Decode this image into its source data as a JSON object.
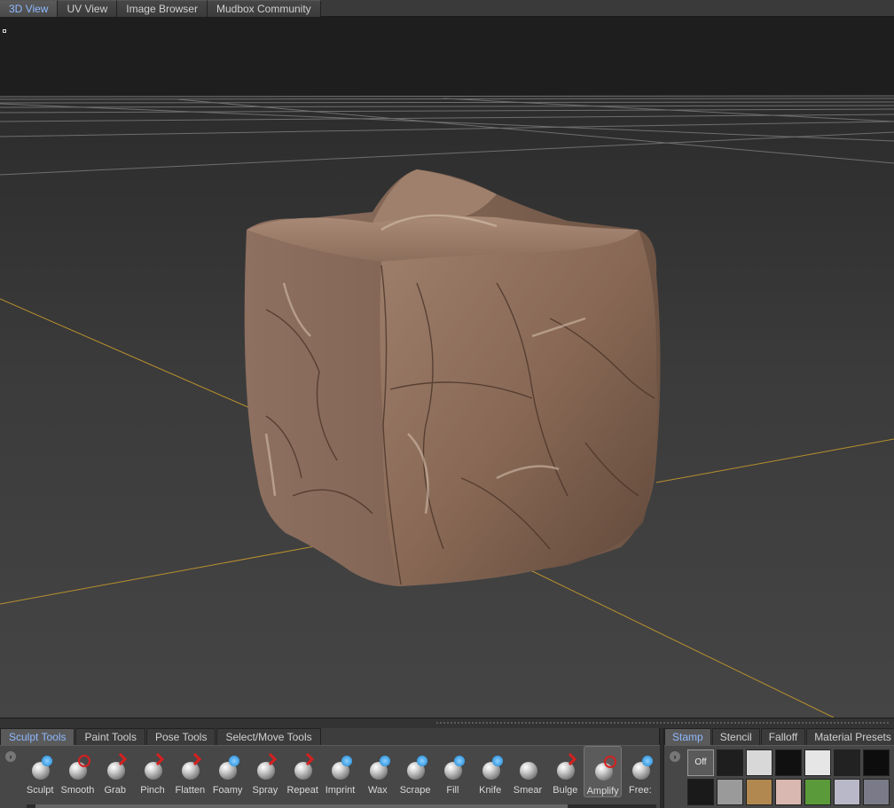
{
  "top_tabs": [
    {
      "label": "3D View",
      "active": true
    },
    {
      "label": "UV View",
      "active": false
    },
    {
      "label": "Image Browser",
      "active": false
    },
    {
      "label": "Mudbox Community",
      "active": false
    }
  ],
  "viewport": {
    "model_color": "#8a6a58",
    "grid_color": "#8a8a8a",
    "axis_color": "#b8902e"
  },
  "tool_tray": {
    "tabs": [
      {
        "label": "Sculpt Tools",
        "active": true
      },
      {
        "label": "Paint Tools",
        "active": false
      },
      {
        "label": "Pose Tools",
        "active": false
      },
      {
        "label": "Select/Move Tools",
        "active": false
      }
    ],
    "expand_icon": "chevron-right-icon",
    "tools": [
      {
        "label": "Sculpt",
        "mark": "blue"
      },
      {
        "label": "Smooth",
        "mark": "red"
      },
      {
        "label": "Grab",
        "mark": "arrow"
      },
      {
        "label": "Pinch",
        "mark": "arrow"
      },
      {
        "label": "Flatten",
        "mark": "arrow"
      },
      {
        "label": "Foamy",
        "mark": "blue"
      },
      {
        "label": "Spray",
        "mark": "arrow"
      },
      {
        "label": "Repeat",
        "mark": "arrow"
      },
      {
        "label": "Imprint",
        "mark": "blue"
      },
      {
        "label": "Wax",
        "mark": "blue"
      },
      {
        "label": "Scrape",
        "mark": "blue"
      },
      {
        "label": "Fill",
        "mark": "blue"
      },
      {
        "label": "Knife",
        "mark": "blue"
      },
      {
        "label": "Smear",
        "mark": "none"
      },
      {
        "label": "Bulge",
        "mark": "arrow"
      },
      {
        "label": "Amplify",
        "mark": "red",
        "selected": true
      },
      {
        "label": "Free:",
        "mark": "blue"
      }
    ]
  },
  "stamp_panel": {
    "tabs": [
      {
        "label": "Stamp",
        "active": true
      },
      {
        "label": "Stencil",
        "active": false
      },
      {
        "label": "Falloff",
        "active": false
      },
      {
        "label": "Material Presets",
        "active": false
      }
    ],
    "off_label": "Off",
    "swatch_colors": [
      "#1e1e1e",
      "#d8d8d8",
      "#101010",
      "#e6e6e6",
      "#222222",
      "#0d0d0d",
      "#1a1a1a",
      "#9a9a9a",
      "#b08850",
      "#d8b8b0",
      "#5a9a3a",
      "#b8b8c8",
      "#7a7a88"
    ]
  }
}
